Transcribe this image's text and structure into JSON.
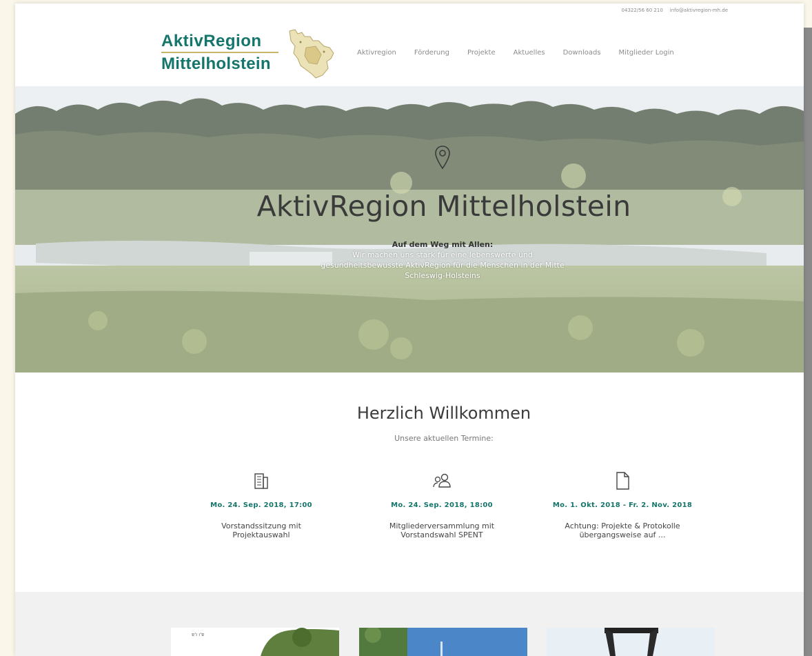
{
  "contact": {
    "phone": "04322/56 60 210",
    "email": "info@aktivregion-mh.de"
  },
  "logo": {
    "line1": "AktivRegion",
    "line2": "Mittelholstein"
  },
  "nav": {
    "items": [
      "Aktivregion",
      "Förderung",
      "Projekte",
      "Aktuelles",
      "Downloads",
      "Mitglieder Login"
    ]
  },
  "hero": {
    "title": "AktivRegion Mittelholstein",
    "tagline": "Auf dem Weg mit Allen:",
    "description": "Wir machen uns stark für eine lebenswerte und gesundheitsbewusste AktivRegion für die Menschen in der Mitte Schleswig-Holsteins"
  },
  "welcome": {
    "title": "Herzlich Willkommen",
    "subtitle": "Unsere aktuellen Termine:"
  },
  "events": [
    {
      "icon": "building-icon",
      "date": "Mo. 24. Sep. 2018, 17:00",
      "title": "Vorstandssitzung mit Projektauswahl"
    },
    {
      "icon": "people-icon",
      "date": "Mo. 24. Sep. 2018, 18:00",
      "title": "Mitgliederversammlung mit Vorstandswahl SPENT"
    },
    {
      "icon": "document-icon",
      "date": "Mo. 1. Okt. 2018 - Fr. 2. Nov. 2018",
      "title": "Achtung: Projekte & Protokolle übergangsweise auf ..."
    }
  ],
  "colors": {
    "brand": "#14766b",
    "accent": "#c8b46a",
    "background": "#fbf6ea"
  }
}
